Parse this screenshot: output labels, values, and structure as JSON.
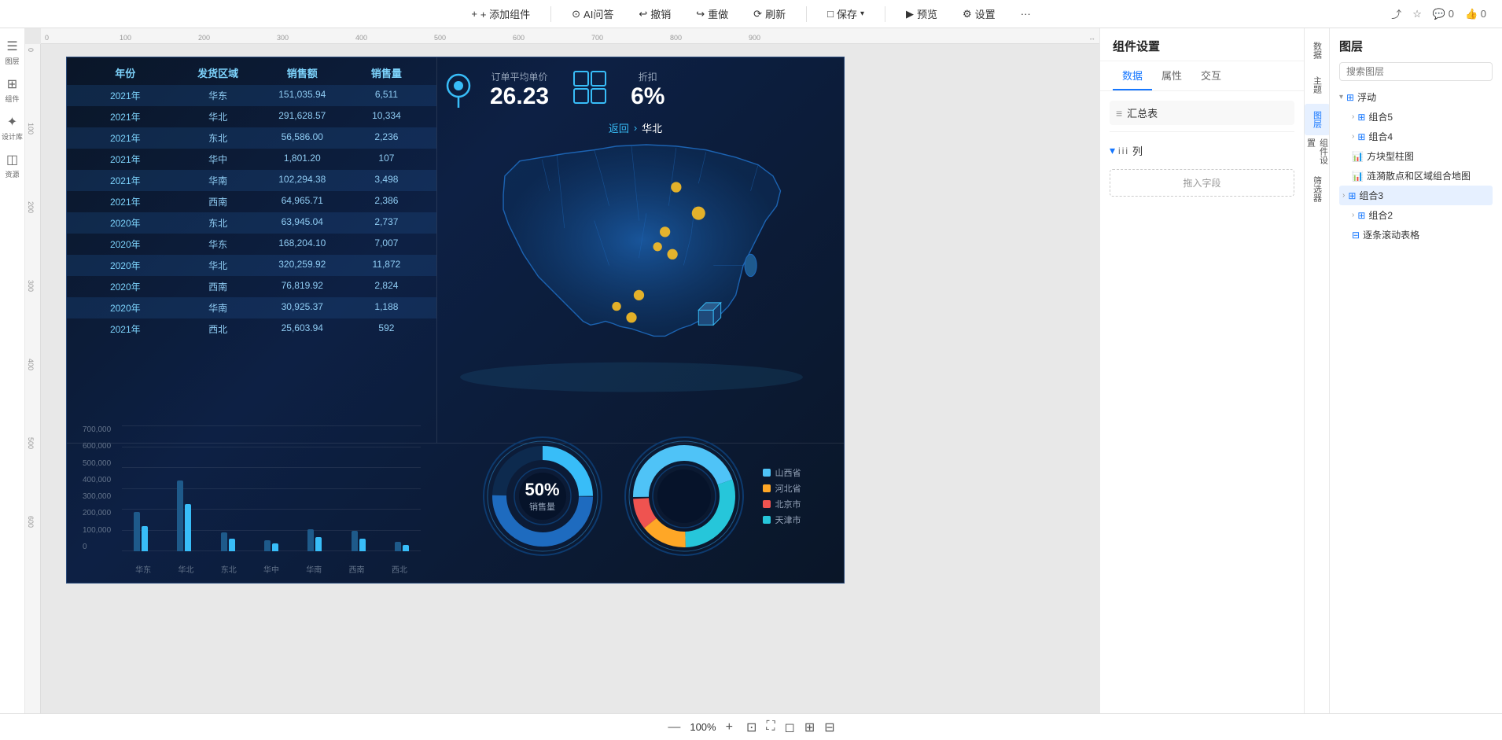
{
  "toolbar": {
    "add_component": "+ 添加组件",
    "ai_qa": "AI问答",
    "undo": "撤销",
    "redo": "重做",
    "refresh": "刷新",
    "save": "保存",
    "save_dropdown": "▾",
    "preview": "预览",
    "settings": "设置",
    "more": "···",
    "share_icon": "⤴",
    "star_icon": "☆",
    "comment_count": "0",
    "like_count": "0"
  },
  "left_sidebar": {
    "items": [
      {
        "id": "layers",
        "icon": "☰",
        "label": "图层",
        "active": false
      },
      {
        "id": "components",
        "icon": "⊞",
        "label": "组件",
        "active": false
      },
      {
        "id": "design",
        "icon": "✦",
        "label": "设计库",
        "active": false
      },
      {
        "id": "assets",
        "icon": "◫",
        "label": "资源",
        "active": false
      }
    ]
  },
  "comp_settings": {
    "title": "组件设置",
    "tabs": [
      "数据",
      "属性",
      "交互"
    ],
    "active_tab": 0,
    "data_source": "汇总表",
    "section_col": "列",
    "drop_hint": "拖入字段"
  },
  "layer_panel": {
    "title": "图层",
    "search_placeholder": "搜索图层",
    "items": [
      {
        "id": "floating",
        "label": "浮动",
        "icon": "⊞",
        "expanded": true,
        "level": 0
      },
      {
        "id": "group5",
        "label": "组合5",
        "icon": "⊞",
        "level": 1
      },
      {
        "id": "group4",
        "label": "组合4",
        "icon": "⊞",
        "level": 1
      },
      {
        "id": "chart1",
        "label": "方块型柱图",
        "icon": "⊞",
        "level": 1,
        "active": false
      },
      {
        "id": "map_chart",
        "label": "涟漪散点和区域组合地图",
        "icon": "⊞",
        "level": 1
      },
      {
        "id": "group3",
        "label": "组合3",
        "icon": "⊞",
        "level": 1,
        "expanded": true,
        "active": true
      },
      {
        "id": "group2",
        "label": "组合2",
        "icon": "⊞",
        "level": 1
      },
      {
        "id": "scroll_table",
        "label": "逐条滚动表格",
        "icon": "⊞",
        "level": 1
      }
    ]
  },
  "far_right": {
    "items": [
      {
        "id": "data-panel",
        "label": "数据"
      },
      {
        "id": "theme-panel",
        "label": "主题"
      },
      {
        "id": "layer-panel",
        "label": "图层",
        "active": true
      },
      {
        "id": "comp-settings",
        "label": "组件设置",
        "active": false
      },
      {
        "id": "filter-panel",
        "label": "筛选器"
      }
    ]
  },
  "dashboard": {
    "table": {
      "headers": [
        "年份",
        "发货区域",
        "销售额",
        "销售量"
      ],
      "rows": [
        [
          "2021年",
          "华东",
          "151,035.94",
          "6,511"
        ],
        [
          "2021年",
          "华北",
          "291,628.57",
          "10,334"
        ],
        [
          "2021年",
          "东北",
          "56,586.00",
          "2,236"
        ],
        [
          "2021年",
          "华中",
          "1,801.20",
          "107"
        ],
        [
          "2021年",
          "华南",
          "102,294.38",
          "3,498"
        ],
        [
          "2021年",
          "西南",
          "64,965.71",
          "2,386"
        ],
        [
          "2020年",
          "东北",
          "63,945.04",
          "2,737"
        ],
        [
          "2020年",
          "华东",
          "168,204.10",
          "7,007"
        ],
        [
          "2020年",
          "华北",
          "320,259.92",
          "11,872"
        ],
        [
          "2020年",
          "西南",
          "76,819.92",
          "2,824"
        ],
        [
          "2020年",
          "华南",
          "30,925.37",
          "1,188"
        ],
        [
          "2021年",
          "西北",
          "25,603.94",
          "592"
        ]
      ]
    },
    "kpi": {
      "order_avg_label": "订单平均单价",
      "order_avg_value": "26.23",
      "discount_label": "折扣",
      "discount_value": "6%"
    },
    "map_nav": {
      "back_label": "返回",
      "region_label": "华北"
    },
    "bar_chart": {
      "y_labels": [
        "700,000",
        "600,000",
        "500,000",
        "400,000",
        "300,000",
        "200,000",
        "100,000",
        "0"
      ],
      "x_labels": [
        "华东",
        "华北",
        "东北",
        "华中",
        "华南",
        "西南",
        "西北"
      ],
      "bars": [
        {
          "dark": 55,
          "light": 35
        },
        {
          "dark": 95,
          "light": 65
        },
        {
          "dark": 25,
          "light": 20
        },
        {
          "dark": 18,
          "light": 14
        },
        {
          "dark": 30,
          "light": 22
        },
        {
          "dark": 28,
          "light": 20
        },
        {
          "dark": 15,
          "light": 10
        }
      ]
    },
    "donut1": {
      "percent": "50%",
      "label": "销售量"
    },
    "donut2": {
      "legend": [
        {
          "label": "山西省",
          "color": "#4fc3f7"
        },
        {
          "label": "河北省",
          "color": "#ffa726"
        },
        {
          "label": "北京市",
          "color": "#ef5350"
        },
        {
          "label": "天津市",
          "color": "#26c6da"
        }
      ]
    }
  },
  "bottom_bar": {
    "zoom_out": "—",
    "zoom_level": "100%",
    "zoom_in": "+"
  }
}
